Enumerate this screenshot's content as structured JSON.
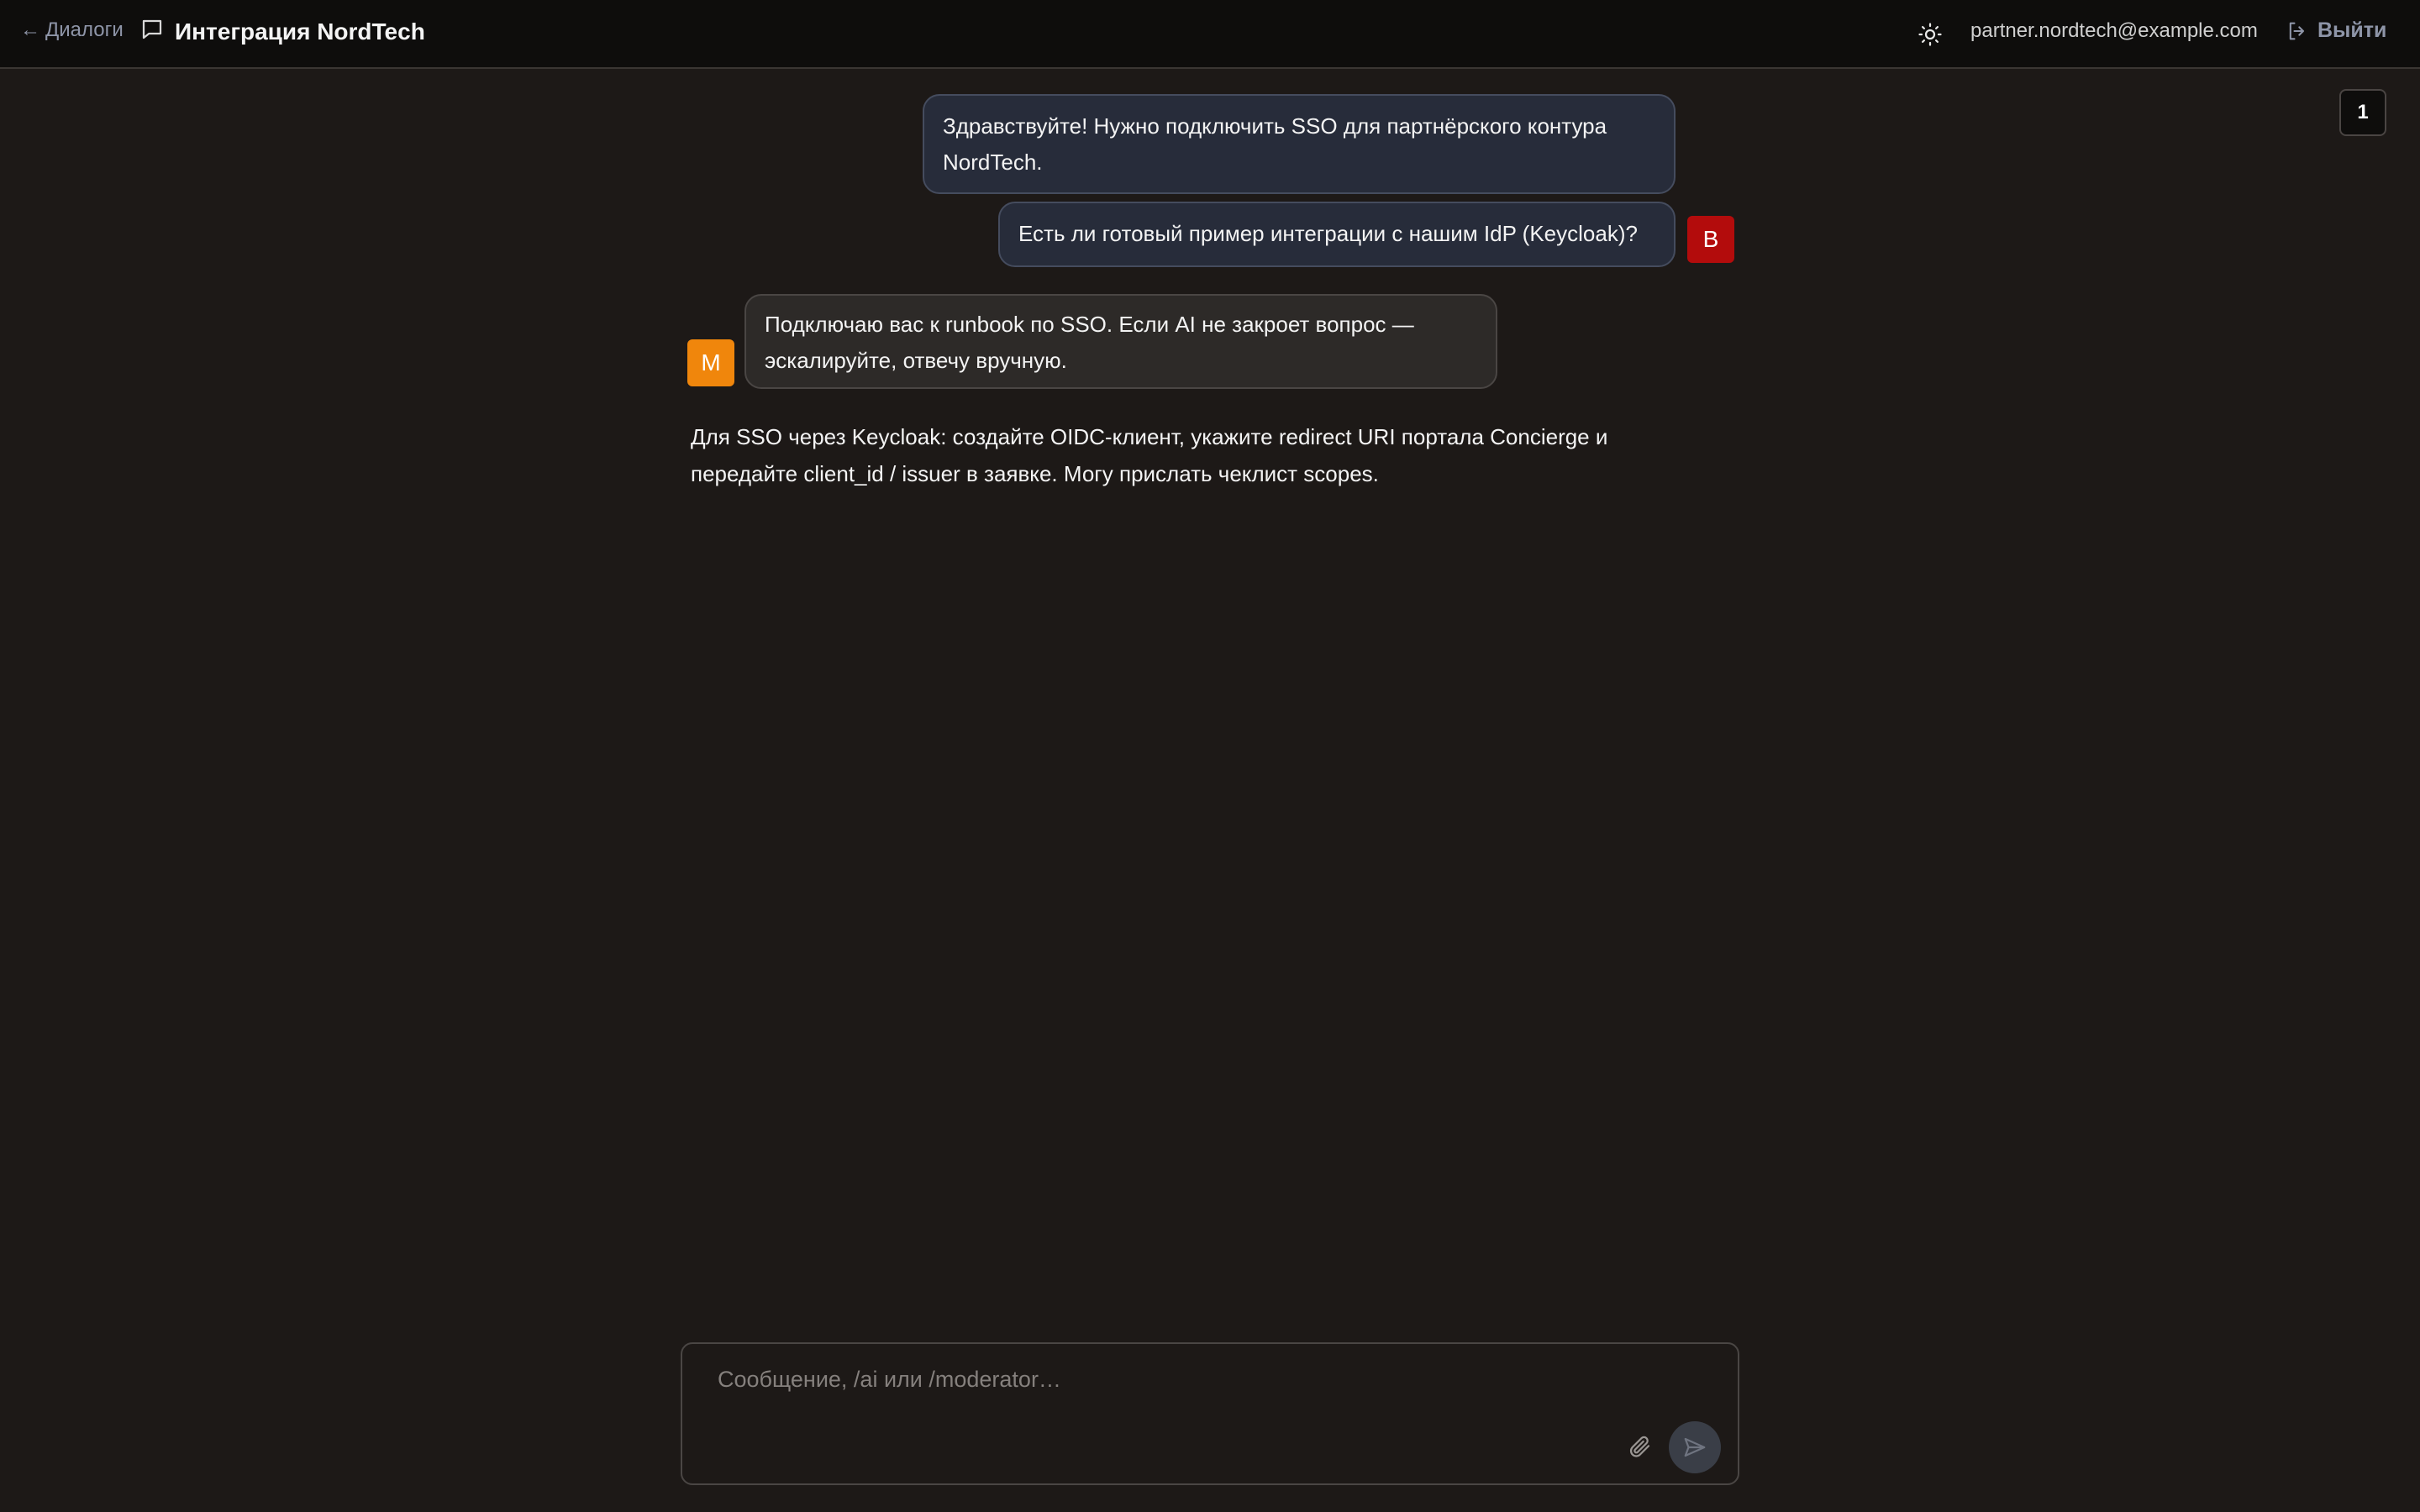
{
  "header": {
    "back_label": "Диалоги",
    "back_arrow": "←",
    "chat_title": "Интеграция NordTech",
    "user_email": "partner.nordtech@example.com",
    "logout_label": "Выйти"
  },
  "page_badge": "1",
  "messages": [
    {
      "role": "user",
      "text": "Здравствуйте! Нужно подключить SSO для партнёрского контура NordTech."
    },
    {
      "role": "user",
      "text": "Есть ли готовый пример интеграции с нашим IdP (Keycloak)?",
      "avatar": "B"
    },
    {
      "role": "moderator",
      "text": "Подключаю вас к runbook по SSO. Если AI не закроет вопрос — эскалируйте, отвечу вручную.",
      "avatar": "M"
    },
    {
      "role": "ai",
      "text": "Для SSO через Keycloak: создайте OIDC-клиент, укажите redirect URI портала Concierge и передайте client_id / issuer в заявке. Могу прислать чеклист scopes."
    }
  ],
  "composer": {
    "placeholder": "Сообщение, /ai или /moderator…",
    "value": ""
  },
  "icons": {
    "chat": "chat-bubble-icon",
    "theme": "sun-icon",
    "logout": "logout-icon",
    "attach": "paperclip-icon",
    "send": "send-icon"
  },
  "colors": {
    "background": "#1d1917",
    "topbar": "#0e0d0c",
    "user_bubble": "#272c3a",
    "moderator_bubble": "#2d2a28",
    "user_avatar": "#b30c0c",
    "moderator_avatar": "#f0860c",
    "link": "#8e95a8"
  }
}
